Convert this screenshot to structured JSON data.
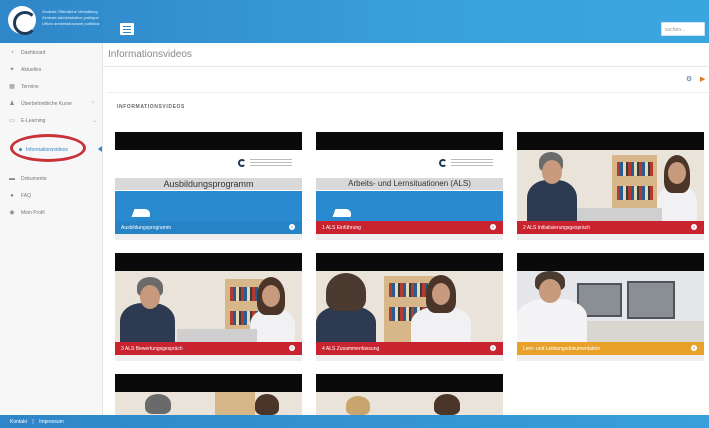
{
  "header": {
    "logo_lines": [
      "Zentrale Öffentliche Verwaltung",
      "Zentrale administrative publique",
      "Ufficio amministrazione pubblica"
    ],
    "search_placeholder": "suchen..."
  },
  "sidebar": {
    "items": [
      {
        "label": "Dashboard",
        "icon": "dashboard-icon",
        "glyph": "◔"
      },
      {
        "label": "Aktuelles",
        "icon": "pin-icon",
        "glyph": "✦"
      },
      {
        "label": "Termine",
        "icon": "calendar-icon",
        "glyph": "▦"
      },
      {
        "label": "Überbetriebliche Kurse",
        "icon": "people-icon",
        "glyph": "♟"
      },
      {
        "label": "E-Learning",
        "icon": "monitor-icon",
        "glyph": "▭"
      },
      {
        "label": "Informationsvideos",
        "icon": "dot-icon",
        "glyph": ""
      },
      {
        "label": "Dokumente",
        "icon": "folder-icon",
        "glyph": "▬"
      },
      {
        "label": "FAQ",
        "icon": "info-icon",
        "glyph": "●"
      },
      {
        "label": "Mein Profil",
        "icon": "user-icon",
        "glyph": "◉"
      }
    ]
  },
  "main": {
    "page_title": "Informationsvideos",
    "section_title": "INFORMATIONSVIDEOS"
  },
  "cards": [
    {
      "caption": "Ausbildungsprogramm",
      "slide_title": "Ausbildungsprogramm",
      "kind": "slide",
      "color": "blue"
    },
    {
      "caption": "1 ALS Einführung",
      "slide_title": "Arbeits- und Lernsituationen (ALS)",
      "kind": "slide",
      "color": "red"
    },
    {
      "caption": "2 ALS Initialisierungsgespräch",
      "kind": "photo",
      "color": "red"
    },
    {
      "caption": "3 ALS Bewertungsgespräch",
      "kind": "photo",
      "color": "red"
    },
    {
      "caption": "4 ALS Zusammenfassung",
      "kind": "photo",
      "color": "red"
    },
    {
      "caption": "Lern- und Leistungsdokumentation",
      "kind": "photo",
      "color": "orange"
    },
    {
      "caption": "",
      "kind": "photo",
      "color": "red"
    },
    {
      "caption": "",
      "kind": "photo",
      "color": "red"
    }
  ],
  "footer": {
    "left": "Kontakt",
    "sep": "|",
    "right": "Impressum"
  },
  "colors": {
    "brand_blue": "#2f86c8",
    "caption_red": "#c8232f",
    "caption_orange": "#e8a22a",
    "annotation_red": "#c9323b"
  }
}
